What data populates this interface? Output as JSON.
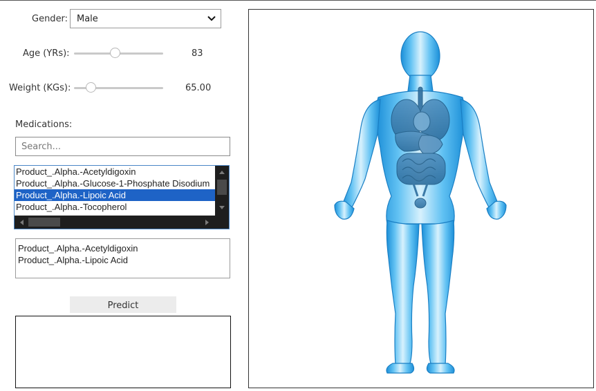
{
  "gender": {
    "label": "Gender:",
    "selected": "Male",
    "options": [
      "Male"
    ]
  },
  "age": {
    "label": "Age (YRs):",
    "value": "83",
    "level": 0.46
  },
  "weight": {
    "label": "Weight (KGs):",
    "value": "65.00",
    "level": 0.15
  },
  "medications": {
    "label": "Medications:",
    "search_placeholder": "Search...",
    "list": [
      "Product_.Alpha.-Acetyldigoxin",
      "Product_.Alpha.-Glucose-1-Phosphate Disodium",
      "Product_.Alpha.-Lipoic Acid",
      "Product_.Alpha.-Tocopherol"
    ],
    "selected_index": 2,
    "selected": [
      "Product_.Alpha.-Acetyldigoxin",
      "Product_.Alpha.-Lipoic Acid"
    ]
  },
  "predict_label": "Predict",
  "result_text": "",
  "colors": {
    "selection": "#1e63c6",
    "scrollbar": "#1e1e1e",
    "body_blue": "#3aa8e6",
    "body_light": "#bfe6fb"
  },
  "figure": {
    "subject": "human-body-anatomy-icon"
  }
}
